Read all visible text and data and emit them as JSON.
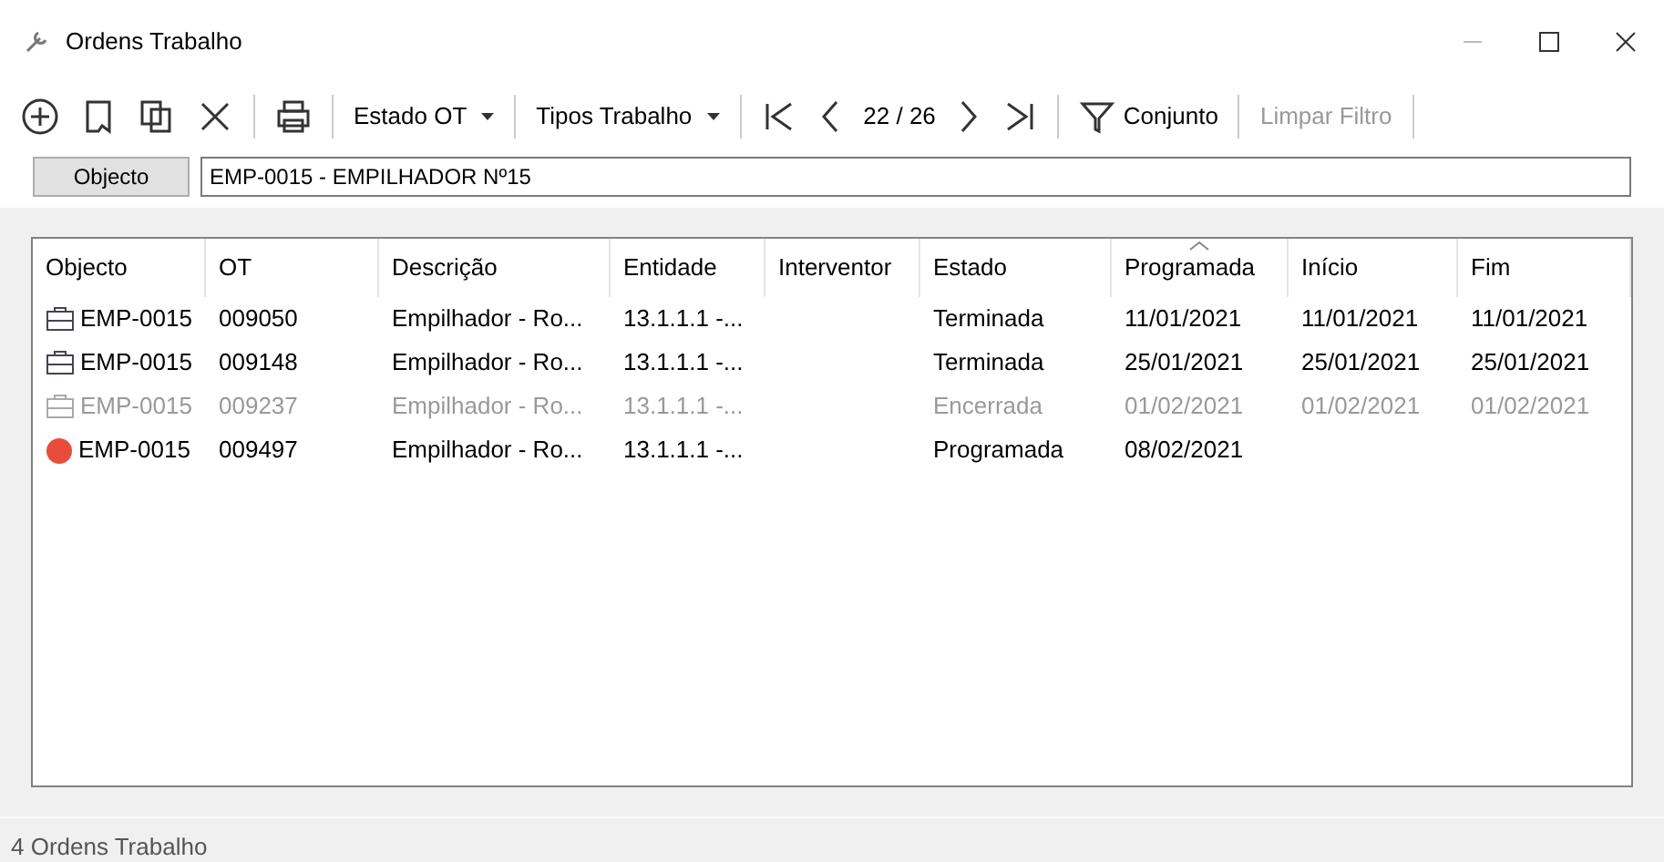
{
  "window": {
    "title": "Ordens Trabalho"
  },
  "toolbar": {
    "dropdowns": [
      {
        "label": "Estado OT"
      },
      {
        "label": "Tipos Trabalho"
      }
    ],
    "pager": "22 / 26",
    "filter": "Conjunto",
    "clear_filter": {
      "label": "Limpar Filtro",
      "disabled": true
    }
  },
  "object_field": {
    "label": "Objecto",
    "value": "EMP-0015 - EMPILHADOR Nº15"
  },
  "table": {
    "columns": [
      {
        "label": "Objecto",
        "sorted": false
      },
      {
        "label": "OT",
        "sorted": false
      },
      {
        "label": "Descrição",
        "sorted": false
      },
      {
        "label": "Entidade",
        "sorted": false
      },
      {
        "label": "Interventor",
        "sorted": false
      },
      {
        "label": "Estado",
        "sorted": false
      },
      {
        "label": "Programada",
        "sorted": true
      },
      {
        "label": "Início",
        "sorted": false
      },
      {
        "label": "Fim",
        "sorted": false
      }
    ],
    "rows": [
      {
        "kind": "briefcase",
        "disabled": false,
        "cells": [
          "EMP-0015",
          "009050",
          "Empilhador - Ro...",
          "13.1.1.1 -...",
          "",
          "Terminada",
          "11/01/2021",
          "11/01/2021",
          "11/01/2021"
        ]
      },
      {
        "kind": "briefcase",
        "disabled": false,
        "cells": [
          "EMP-0015",
          "009148",
          "Empilhador - Ro...",
          "13.1.1.1 -...",
          "",
          "Terminada",
          "25/01/2021",
          "25/01/2021",
          "25/01/2021"
        ]
      },
      {
        "kind": "briefcase",
        "disabled": true,
        "cells": [
          "EMP-0015",
          "009237",
          "Empilhador - Ro...",
          "13.1.1.1 -...",
          "",
          "Encerrada",
          "01/02/2021",
          "01/02/2021",
          "01/02/2021"
        ]
      },
      {
        "kind": "dot",
        "color": "#e74c3c",
        "disabled": false,
        "cells": [
          "EMP-0015",
          "009497",
          "Empilhador - Ro...",
          "13.1.1.1 -...",
          "",
          "Programada",
          "08/02/2021",
          "",
          ""
        ]
      }
    ]
  },
  "status_bar": "4 Ordens Trabalho"
}
